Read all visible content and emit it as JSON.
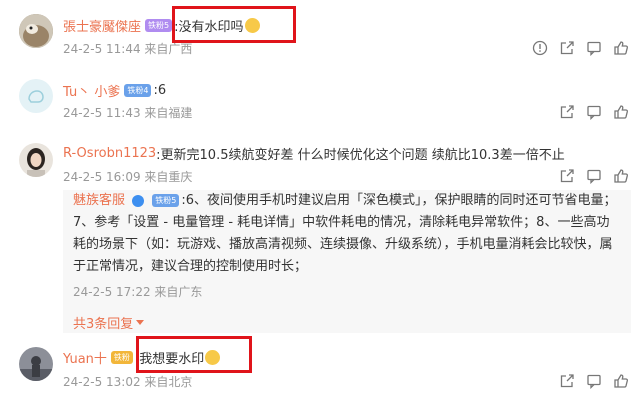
{
  "comments": [
    {
      "user": "張士豪魘傑座",
      "badge": "铁粉5",
      "text": ":没有水印吗",
      "meta": "24-2-5 11:44 来自广西"
    },
    {
      "user": "Tu丶 小爹",
      "badge": "铁粉4",
      "text": ":6",
      "meta": "24-2-5 11:43 来自福建"
    },
    {
      "user": "R-Osrobn1123",
      "text": ":更新完10.5续航变好差 什么时候优化这个问题 续航比10.3差一倍不止",
      "meta": "24-2-5 16:09 来自重庆",
      "reply": {
        "user": "魅族客服",
        "badge": "铁粉5",
        "text": ":6、夜间使用手机时建议启用「深色模式」，保护眼睛的同时还可节省电量；7、参考「设置 - 电量管理 - 耗电详情」中软件耗电的情况，清除耗电异常软件；8、一些高功耗的场景下（如：玩游戏、播放高清视频、连续摄像、升级系统），手机电量消耗会比较快，属于正常情况，建议合理的控制使用时长；",
        "meta": "24-2-5 17:22 来自广东",
        "more": "共3条回复"
      }
    },
    {
      "user": "Yuan十",
      "badge": "铁粉",
      "text": ":我想要水印",
      "meta": "24-2-5 13:02 来自北京"
    }
  ],
  "colors": {
    "username": "#eb7350",
    "highlight": "#e0141a",
    "meta": "#999999",
    "badge_purple": "#b08cf0",
    "badge_blue": "#6aa1ea",
    "badge_gold": "#f2b63a"
  },
  "icons": [
    "report-icon",
    "share-icon",
    "comment-icon",
    "like-icon",
    "verified-icon",
    "chevron-down-icon"
  ]
}
